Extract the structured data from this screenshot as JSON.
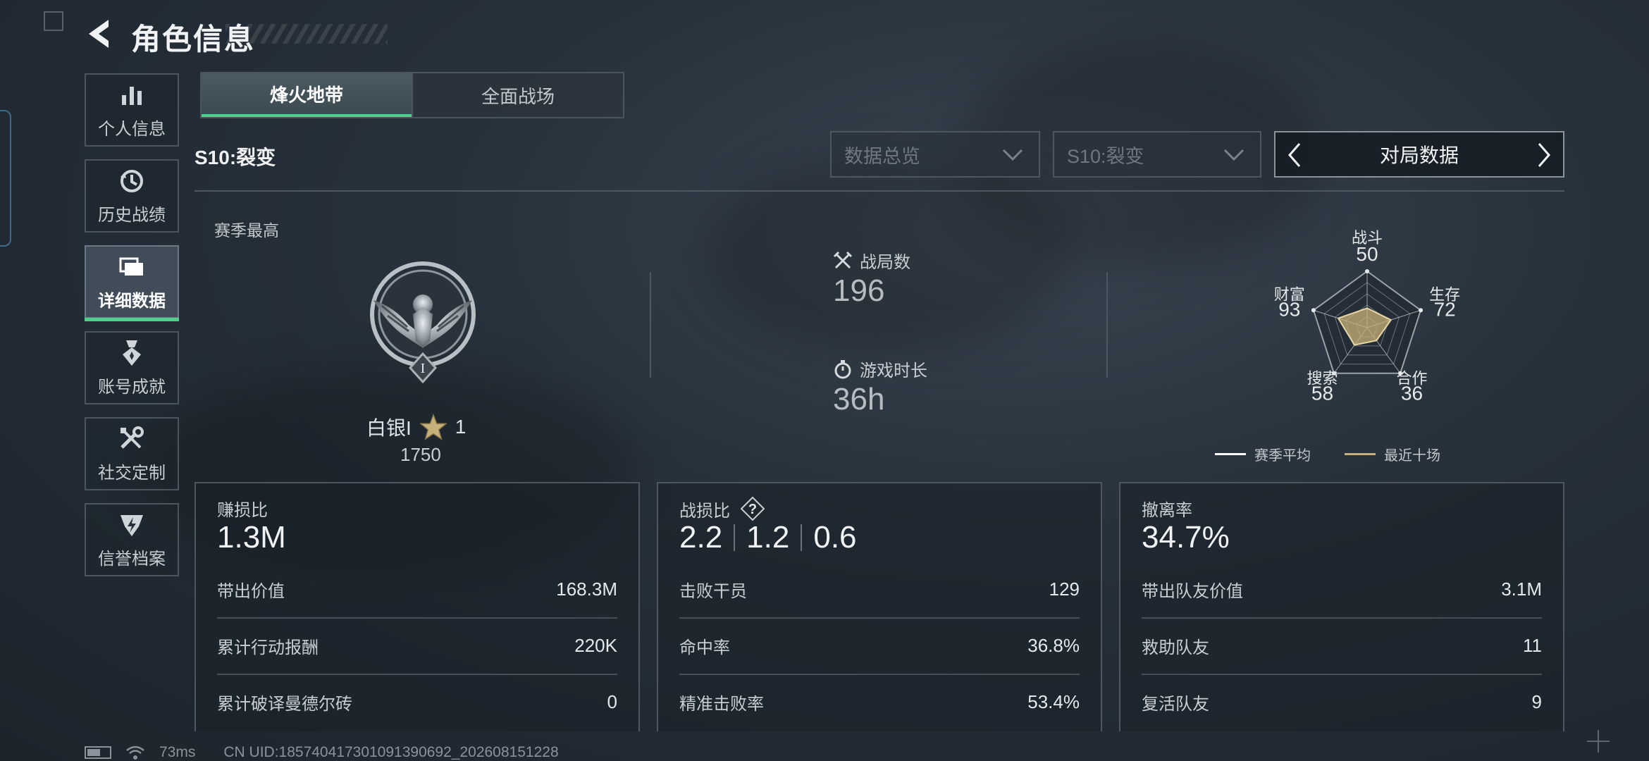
{
  "header": {
    "title": "角色信息"
  },
  "sidebar": {
    "items": [
      {
        "label": "个人信息",
        "icon": "bar-chart-icon",
        "active": false
      },
      {
        "label": "历史战绩",
        "icon": "history-icon",
        "active": false
      },
      {
        "label": "详细数据",
        "icon": "cards-icon",
        "active": true
      },
      {
        "label": "账号成就",
        "icon": "medal-icon",
        "active": false
      },
      {
        "label": "社交定制",
        "icon": "tools-icon",
        "active": false
      },
      {
        "label": "信誉档案",
        "icon": "shield-bolt-icon",
        "active": false
      }
    ]
  },
  "mode_tabs": [
    {
      "label": "烽火地带",
      "active": true
    },
    {
      "label": "全面战场",
      "active": false
    }
  ],
  "season_label": "S10:裂变",
  "filters": {
    "overview": "数据总览",
    "season": "S10:裂变",
    "stat_type": "对局数据"
  },
  "rank": {
    "section_title": "赛季最高",
    "tier": "白银I",
    "stars": "1",
    "score": "1750"
  },
  "summary": {
    "matches_label": "战局数",
    "matches_value": "196",
    "playtime_label": "游戏时长",
    "playtime_value": "36h"
  },
  "radar": {
    "axes": [
      {
        "label": "战斗",
        "value": "50"
      },
      {
        "label": "生存",
        "value": "72"
      },
      {
        "label": "合作",
        "value": "36"
      },
      {
        "label": "搜索",
        "value": "58"
      },
      {
        "label": "财富",
        "value": "93"
      }
    ],
    "legend": {
      "season_avg": "赛季平均",
      "recent_ten": "最近十场"
    },
    "colors": {
      "season_avg": "#ffffff",
      "recent_ten": "#c9b27a"
    }
  },
  "cards": {
    "profit": {
      "title": "赚损比",
      "big": "1.3M",
      "rows": [
        {
          "k": "带出价值",
          "v": "168.3M"
        },
        {
          "k": "累计行动报酬",
          "v": "220K"
        },
        {
          "k": "累计破译曼德尔砖",
          "v": "0"
        }
      ]
    },
    "kd": {
      "title": "战损比",
      "big": [
        "2.2",
        "1.2",
        "0.6"
      ],
      "rows": [
        {
          "k": "击败干员",
          "v": "129"
        },
        {
          "k": "命中率",
          "v": "36.8%"
        },
        {
          "k": "精准击败率",
          "v": "53.4%"
        }
      ]
    },
    "extract": {
      "title": "撤离率",
      "big": "34.7%",
      "rows": [
        {
          "k": "带出队友价值",
          "v": "3.1M"
        },
        {
          "k": "救助队友",
          "v": "11"
        },
        {
          "k": "复活队友",
          "v": "9"
        }
      ]
    }
  },
  "footer": {
    "ping": "73ms",
    "uid": "CN UID:185740417301091390692_202608151228",
    "battery_level": 0.6
  },
  "colors": {
    "accent": "#4fd08a"
  }
}
